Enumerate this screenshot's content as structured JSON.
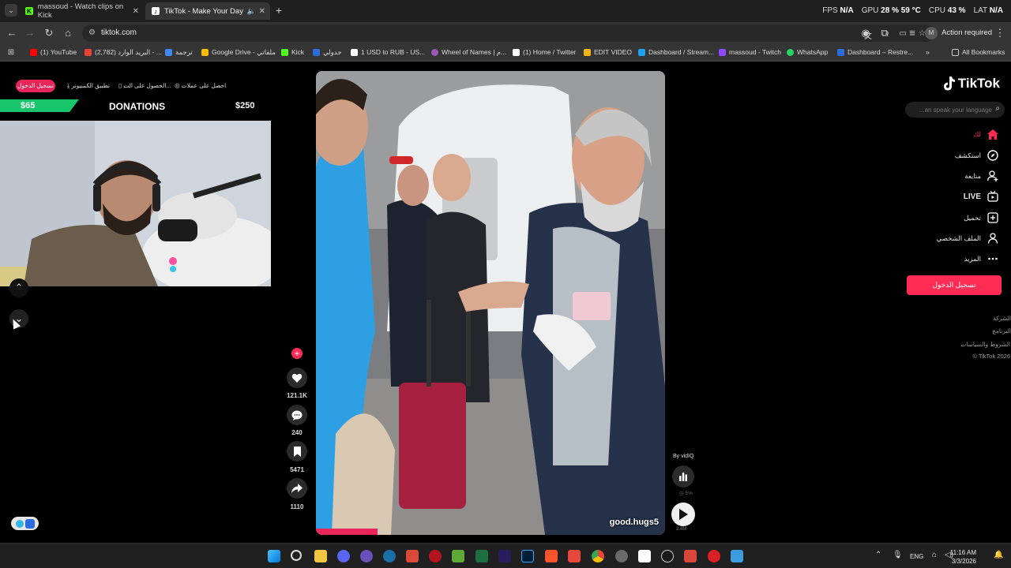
{
  "browser": {
    "tabs": [
      {
        "label": "massoud - Watch clips on Kick",
        "favicon": "K"
      },
      {
        "label": "TikTok - Make Your Day",
        "favicon": "♪"
      }
    ],
    "new_tab": "+",
    "perf": {
      "fps_label": "FPS",
      "fps": "N/A",
      "gpu_label": "GPU",
      "gpu": "28 %",
      "gpu_temp": "59 °C",
      "cpu_label": "CPU",
      "cpu": "43 %",
      "lat_label": "LAT",
      "lat": "N/A"
    },
    "url": "tiktok.com",
    "action_required": "Action required",
    "bookmarks": [
      {
        "label": "YouTube",
        "color": "#ff0000"
      },
      {
        "label": "(2,782) البريد الوارد - ...",
        "color": "#ea4335"
      },
      {
        "label": "ترجمة",
        "color": "#4285f4"
      },
      {
        "label": "Google Drive - ملفاتي",
        "color": "#fbbc04"
      },
      {
        "label": "Kick",
        "color": "#53fc18"
      },
      {
        "label": "جدولي",
        "color": "#2d6cdf"
      },
      {
        "label": "1 USD to RUB - US...",
        "color": "#ffffff"
      },
      {
        "label": "Wheel of Names | م...",
        "color": "#9b59b6"
      },
      {
        "label": "(1) Home / Twitter",
        "color": "#ffffff"
      },
      {
        "label": "EDIT VIDEO",
        "color": "#f4b400"
      },
      {
        "label": "Dashboard / Stream...",
        "color": "#1da1f2"
      },
      {
        "label": "massoud - Twitch",
        "color": "#9146ff"
      },
      {
        "label": "WhatsApp",
        "color": "#25d366"
      },
      {
        "label": "Dashboard – Restre...",
        "color": "#2d6cdf"
      }
    ],
    "all_bookmarks": "All Bookmarks",
    "youtube_prefix": "(1)"
  },
  "overlay": {
    "login": "تسجيل الدخول",
    "menu": [
      "تطبيق الكمبيوتر",
      "الحصول على الت...",
      "احصل على عملات"
    ],
    "donations": {
      "title": "DONATIONS",
      "current": "$65",
      "goal": "$250",
      "progress": 0.26
    }
  },
  "video": {
    "handle": "good.hugs5",
    "stats": {
      "likes": "121.1K",
      "comments": "240",
      "saves": "5471",
      "shares": "1110"
    },
    "by": "By vidIQ",
    "percent": "5%",
    "views": "2.4M"
  },
  "tiktok": {
    "logo": "TikTok",
    "search_placeholder": "...an speak your language",
    "nav": [
      {
        "label": "لك",
        "icon": "home-icon"
      },
      {
        "label": "استكشف",
        "icon": "compass-icon"
      },
      {
        "label": "متابعة",
        "icon": "follow-icon"
      },
      {
        "label": "LIVE",
        "icon": "live-icon"
      },
      {
        "label": "تحميل",
        "icon": "upload-icon"
      },
      {
        "label": "الملف الشخصي",
        "icon": "profile-icon"
      },
      {
        "label": "المزيد",
        "icon": "more-icon"
      }
    ],
    "login": "تسجيل الدخول",
    "footer": [
      "الشركة",
      "البرنامج",
      "الشروط والسياسات",
      "© TikTok 2026"
    ]
  },
  "taskbar": {
    "lang": "ENG",
    "time": "11:16 AM",
    "date": "3/3/2026"
  }
}
